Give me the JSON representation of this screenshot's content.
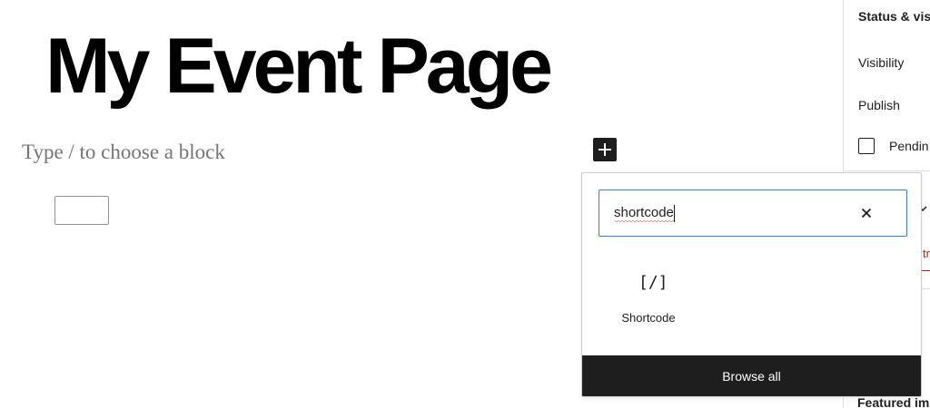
{
  "editor": {
    "post_title": "My Event Page",
    "block_placeholder": "Type / to choose a block"
  },
  "inserter": {
    "search_value": "shortcode",
    "results": [
      {
        "icon_text": "[/]",
        "label": "Shortcode",
        "icon": "shortcode-icon"
      }
    ],
    "browse_all_label": "Browse all"
  },
  "sidebar": {
    "status_heading": "Status & vis",
    "visibility_label": "Visibility",
    "publish_label": "Publish",
    "pending_label": "Pendin",
    "error_text": "tr",
    "featured_heading": "Featured im"
  },
  "colors": {
    "accent": "#3582c4",
    "dark": "#1e1e1e",
    "error": "#cc1818",
    "placeholder": "#757575"
  }
}
